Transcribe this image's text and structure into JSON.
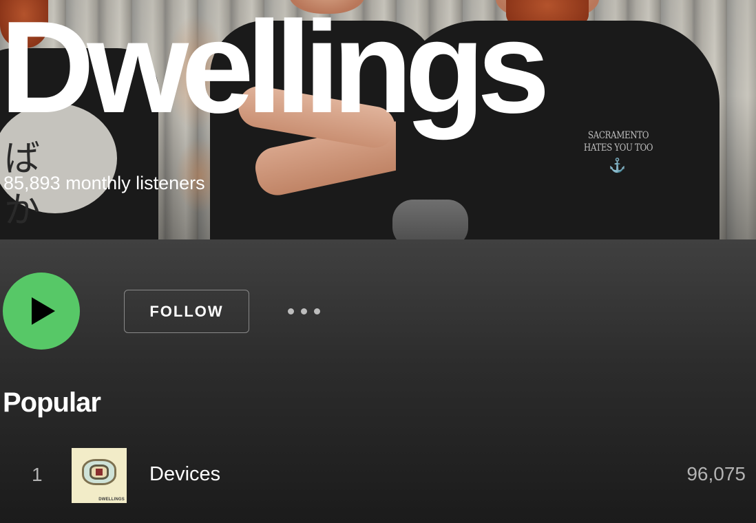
{
  "artist": {
    "name": "Dwellings",
    "monthly_listeners": "85,893 monthly listeners",
    "photo_shirt_text_kana": "ばか",
    "photo_shirt_text_right": "SACRAMENTO HATES YOU TOO"
  },
  "actions": {
    "follow_label": "FOLLOW",
    "play_icon": "play-icon",
    "more_icon": "more-options-icon"
  },
  "popular": {
    "title": "Popular",
    "tracks": [
      {
        "number": "1",
        "title": "Devices",
        "plays": "96,075",
        "art_label": "DWELLINGS"
      }
    ]
  },
  "colors": {
    "play_button": "#57c867",
    "background_top": "#404040",
    "background_bottom": "#1b1b1b",
    "secondary_text": "#b3b3b3"
  }
}
